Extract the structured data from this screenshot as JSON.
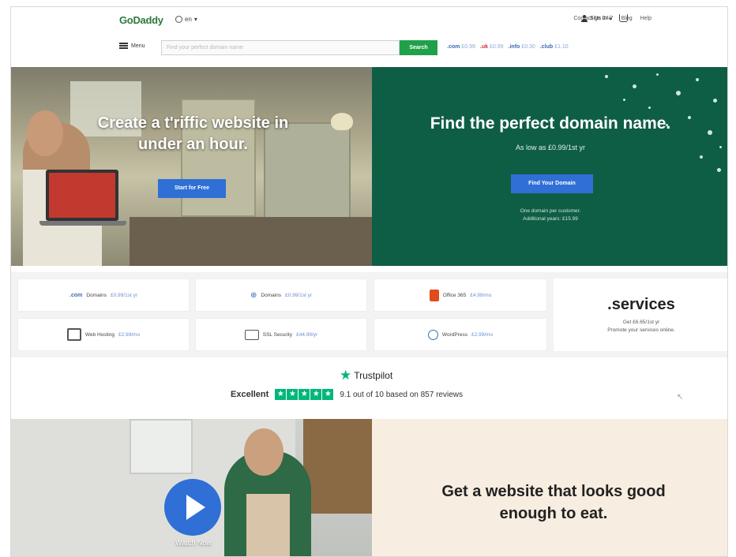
{
  "header": {
    "logo": "GoDaddy",
    "market": "en",
    "links": [
      "Contact Us 24/7",
      "Blog",
      "Help"
    ],
    "signin": "Sign In"
  },
  "search": {
    "menu_label": "Menu",
    "placeholder": "Find your perfect domain name",
    "button": "Search",
    "tlds": [
      {
        "name": ".com",
        "price": "£0.99"
      },
      {
        "name": ".uk",
        "price": "£0.99"
      },
      {
        "name": ".info",
        "price": "£0.30"
      },
      {
        "name": ".club",
        "price": "£1.10"
      }
    ]
  },
  "hero": {
    "left_title": "Create a t'riffic website in under an hour.",
    "left_button": "Start for Free",
    "right_title": "Find the perfect domain name.",
    "right_subtitle": "As low as £0.99/1st yr",
    "right_button": "Find Your Domain",
    "right_note_1": "One domain per customer.",
    "right_note_2": "Additional years: £15.99"
  },
  "products": {
    "domains_com": {
      "tag": ".com",
      "label": "Domains",
      "price": "£0.99/1st yr"
    },
    "domains_uk": {
      "label": "Domains",
      "price": "£0.99/1st yr"
    },
    "office": {
      "label": "Office 365",
      "price": "£4.99/mo"
    },
    "hosting": {
      "label": "Web Hosting",
      "price": "£2.99/mo"
    },
    "ssl": {
      "label": "SSL Security",
      "price": "£44.99/yr"
    },
    "wordpress": {
      "label": "WordPress",
      "price": "£2.99/mo"
    },
    "services": {
      "title": ".services",
      "line1": "Get £6.65/1st yr",
      "line2": "Promote your services online."
    }
  },
  "trustpilot": {
    "brand": "Trustpilot",
    "rating_word": "Excellent",
    "score_text": "9.1 out of 10 based on 857 reviews",
    "stars": 5
  },
  "bottom": {
    "watch_label": "Watch Now",
    "title": "Get a website that looks good enough to eat."
  },
  "colors": {
    "green_panel": "#0e5e45",
    "cta_blue": "#2f6fd6",
    "search_green": "#21a04a",
    "trustpilot_green": "#00b67a"
  }
}
